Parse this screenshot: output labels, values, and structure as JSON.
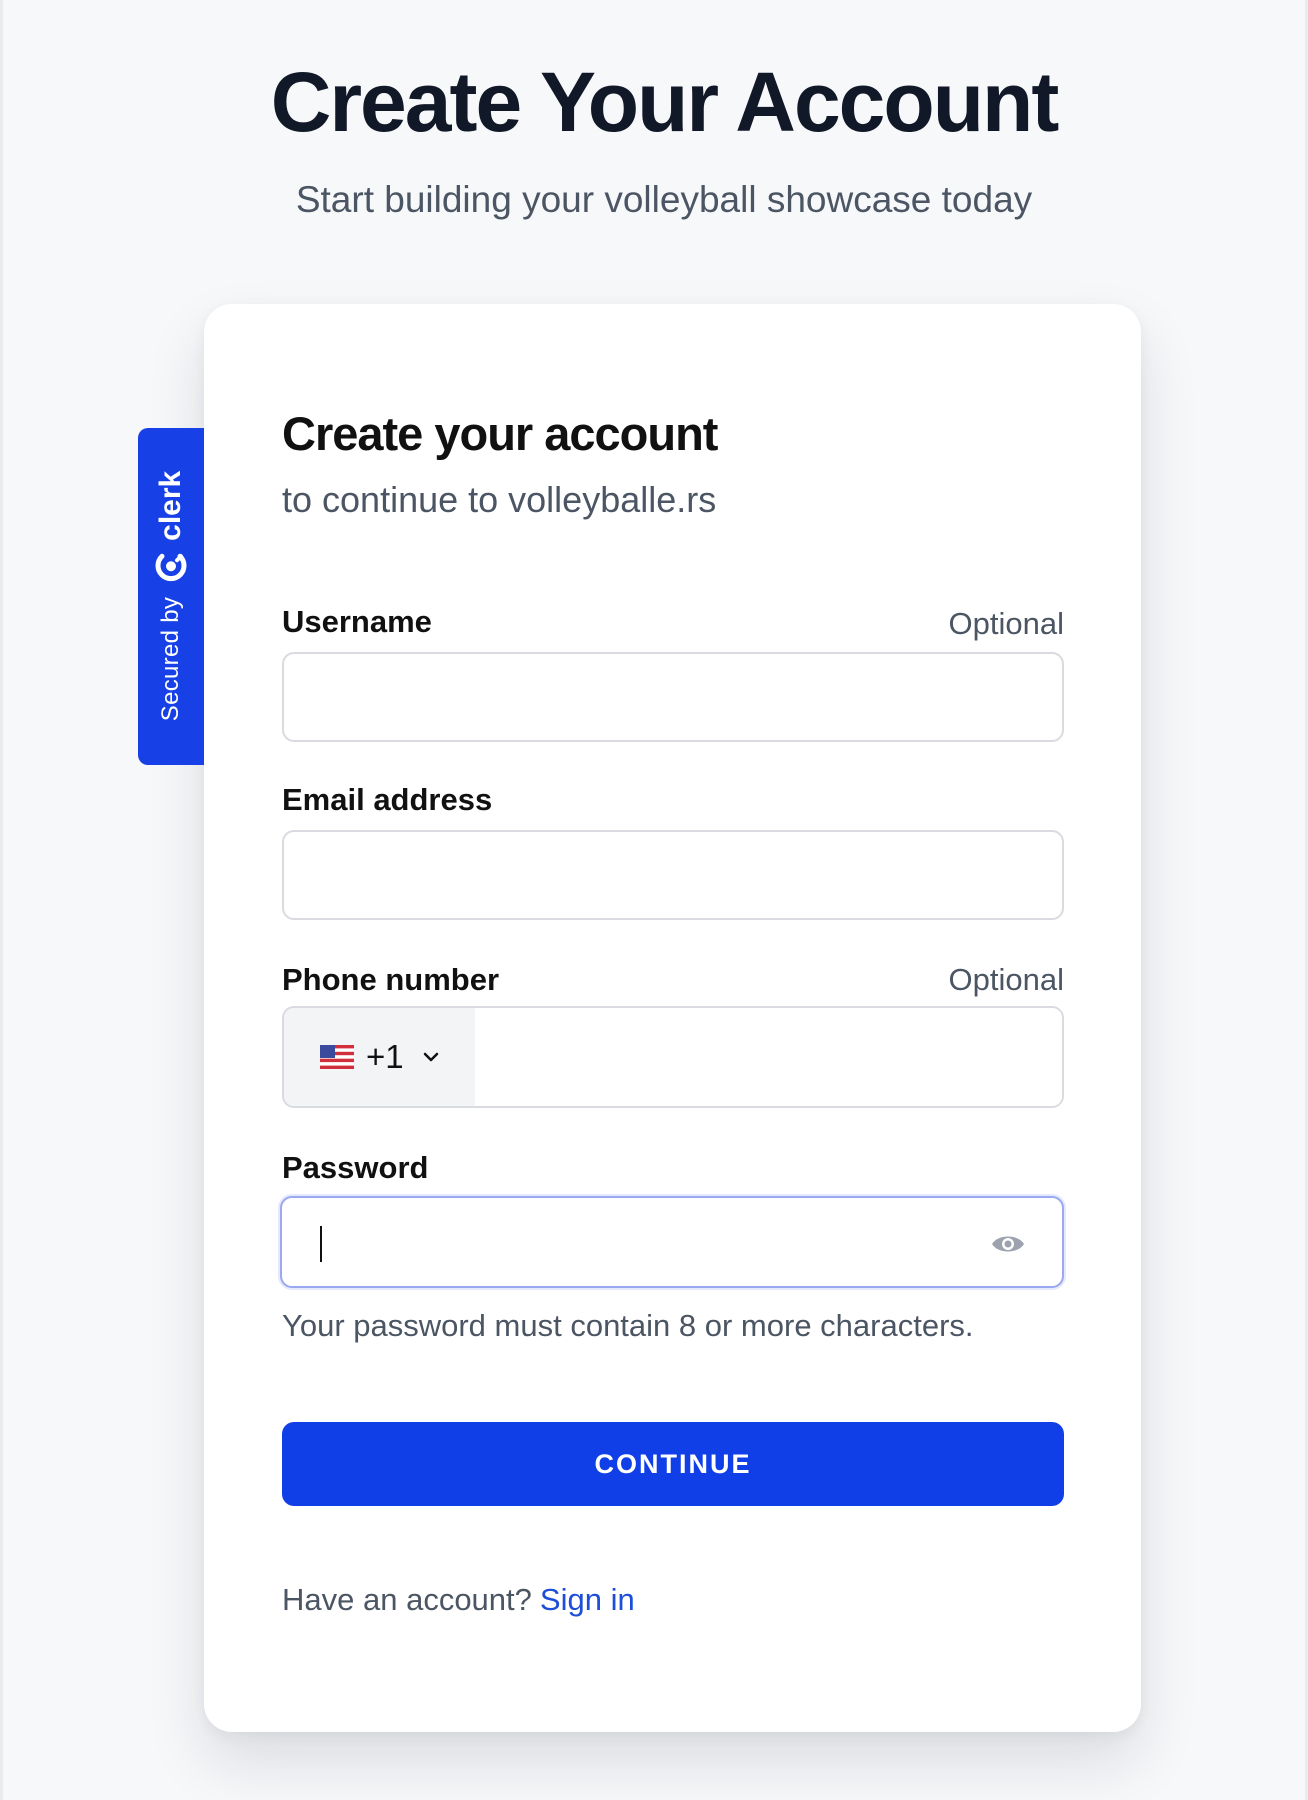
{
  "page": {
    "title": "Create Your Account",
    "subtitle": "Start building your volleyball showcase today"
  },
  "badge": {
    "secured_by": "Secured by",
    "brand": "clerk",
    "color": "#1740e6"
  },
  "card": {
    "title": "Create your account",
    "subtitle": "to continue to volleyballe.rs"
  },
  "fields": {
    "username": {
      "label": "Username",
      "optional": "Optional",
      "value": ""
    },
    "email": {
      "label": "Email address",
      "value": ""
    },
    "phone": {
      "label": "Phone number",
      "optional": "Optional",
      "country_flag": "us-flag-icon",
      "dial_code": "+1",
      "value": ""
    },
    "password": {
      "label": "Password",
      "value": "",
      "hint": "Your password must contain 8 or more characters.",
      "toggle_icon": "eye-icon"
    }
  },
  "actions": {
    "continue_label": "CONTINUE",
    "have_account": "Have an account?",
    "sign_in": "Sign in"
  },
  "colors": {
    "primary": "#103fe8",
    "link": "#1d4ed8",
    "background": "#f7f8fa"
  }
}
